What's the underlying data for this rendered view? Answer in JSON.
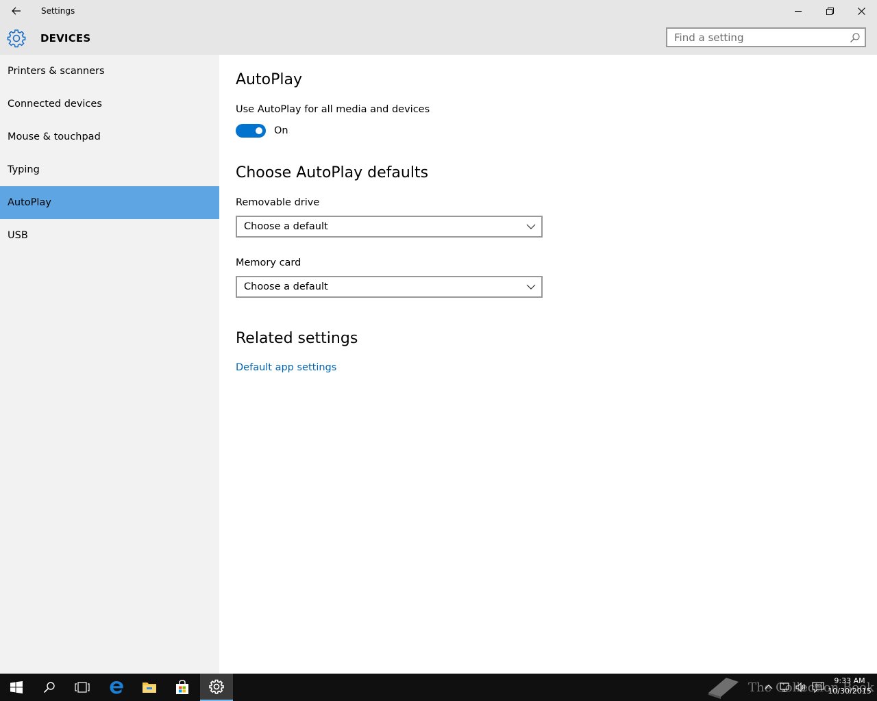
{
  "window": {
    "title": "Settings",
    "back_icon": "back-arrow-icon",
    "minimize_icon": "minimize-icon",
    "maximize_icon": "restore-icon",
    "close_icon": "close-icon"
  },
  "header": {
    "icon": "gear-icon",
    "title": "DEVICES",
    "search_placeholder": "Find a setting",
    "search_value": ""
  },
  "sidebar": {
    "items": [
      {
        "label": "Printers & scanners",
        "selected": false
      },
      {
        "label": "Connected devices",
        "selected": false
      },
      {
        "label": "Mouse & touchpad",
        "selected": false
      },
      {
        "label": "Typing",
        "selected": false
      },
      {
        "label": "AutoPlay",
        "selected": true
      },
      {
        "label": "USB",
        "selected": false
      }
    ]
  },
  "main": {
    "title": "AutoPlay",
    "autoplay_toggle": {
      "label": "Use AutoPlay for all media and devices",
      "on": true,
      "state_text": "On"
    },
    "defaults_heading": "Choose AutoPlay defaults",
    "removable_drive": {
      "label": "Removable drive",
      "value": "Choose a default"
    },
    "memory_card": {
      "label": "Memory card",
      "value": "Choose a default"
    },
    "related_heading": "Related settings",
    "related_link": "Default app settings"
  },
  "taskbar": {
    "items": [
      "start-icon",
      "search-icon",
      "task-view-icon",
      "edge-icon",
      "file-explorer-icon",
      "store-icon",
      "settings-icon"
    ],
    "active": "settings-icon",
    "watermark": "The Collection Book",
    "time": "9:33 AM",
    "date": "10/30/2015"
  },
  "colors": {
    "accent": "#0073cf",
    "nav_selected": "#5ea5e4",
    "link": "#0063b1",
    "chrome": "#e6e6e6",
    "sidebar": "#f2f2f2",
    "taskbar": "#101010"
  }
}
